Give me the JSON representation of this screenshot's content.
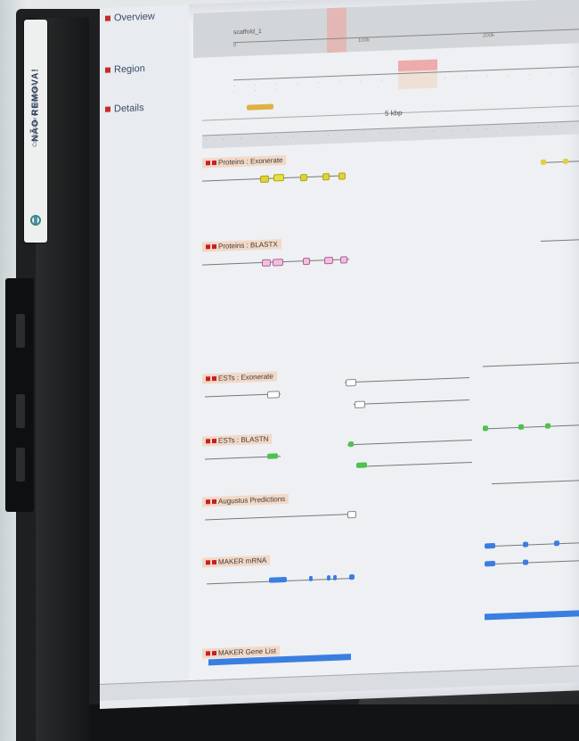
{
  "sticker": {
    "title": "NÃO REMOVA!",
    "subtitle": "Computador do laboratório"
  },
  "sections": {
    "overview": "Overview",
    "region": "Region",
    "details": "Details"
  },
  "overview": {
    "seq_label": "scaffold_1",
    "ticks": [
      "0",
      "100k",
      "200k"
    ]
  },
  "details": {
    "scale_label": "5 kbp"
  },
  "tracks": [
    {
      "title": "Proteins : Exonerate"
    },
    {
      "title": "Proteins : BLASTX"
    },
    {
      "title": "ESTs : Exonerate"
    },
    {
      "title": "ESTs : BLASTN"
    },
    {
      "title": "Augustus Predictions"
    },
    {
      "title": "MAKER mRNA"
    },
    {
      "title": "MAKER Gene List"
    }
  ],
  "colors": {
    "gene_blue": "#3a7ee0",
    "track_header": "#f5c8aa",
    "highlight": "#f08c8c"
  }
}
